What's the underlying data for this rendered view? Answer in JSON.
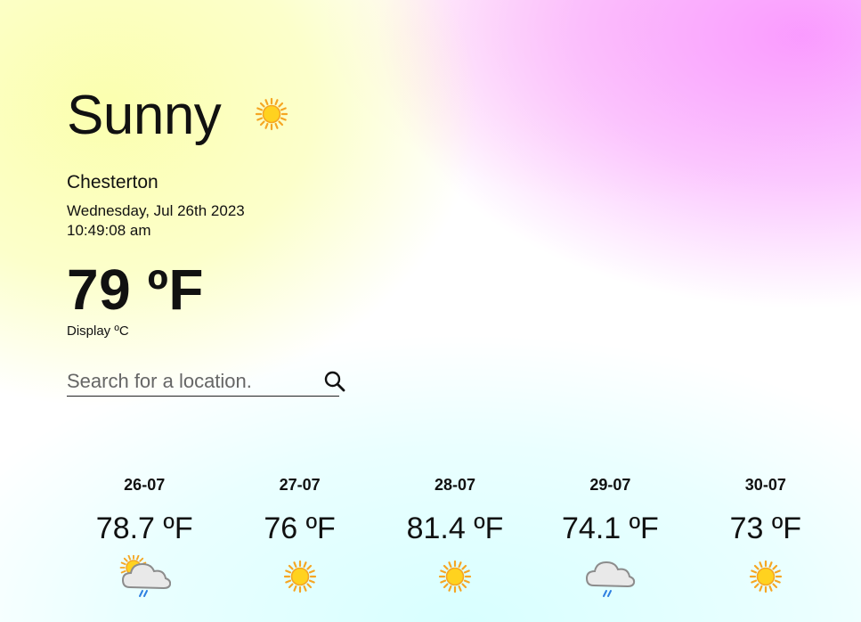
{
  "current": {
    "condition": "Sunny",
    "condition_icon": "sun-icon",
    "location": "Chesterton",
    "date": "Wednesday, Jul 26th 2023",
    "time": "10:49:08 am",
    "temperature": "79 ºF",
    "unit_toggle": "Display ºC"
  },
  "search": {
    "placeholder": "Search for a location.",
    "value": "",
    "button_icon": "search-icon"
  },
  "forecast": [
    {
      "date": "26-07",
      "temp": "78.7 ºF",
      "icon": "sun-behind-rain-cloud-icon"
    },
    {
      "date": "27-07",
      "temp": "76 ºF",
      "icon": "sun-icon"
    },
    {
      "date": "28-07",
      "temp": "81.4 ºF",
      "icon": "sun-icon"
    },
    {
      "date": "29-07",
      "temp": "74.1 ºF",
      "icon": "rain-cloud-icon"
    },
    {
      "date": "30-07",
      "temp": "73 ºF",
      "icon": "sun-icon"
    }
  ],
  "colors": {
    "yellow_glow": "#fbffaa",
    "pink_glow": "#f996ff",
    "cyan_glow": "#d6ffff",
    "sun": "#ffd21f",
    "sun_rays": "#f5a623",
    "cloud": "#e6e6e6",
    "rain": "#2d7fe0"
  }
}
